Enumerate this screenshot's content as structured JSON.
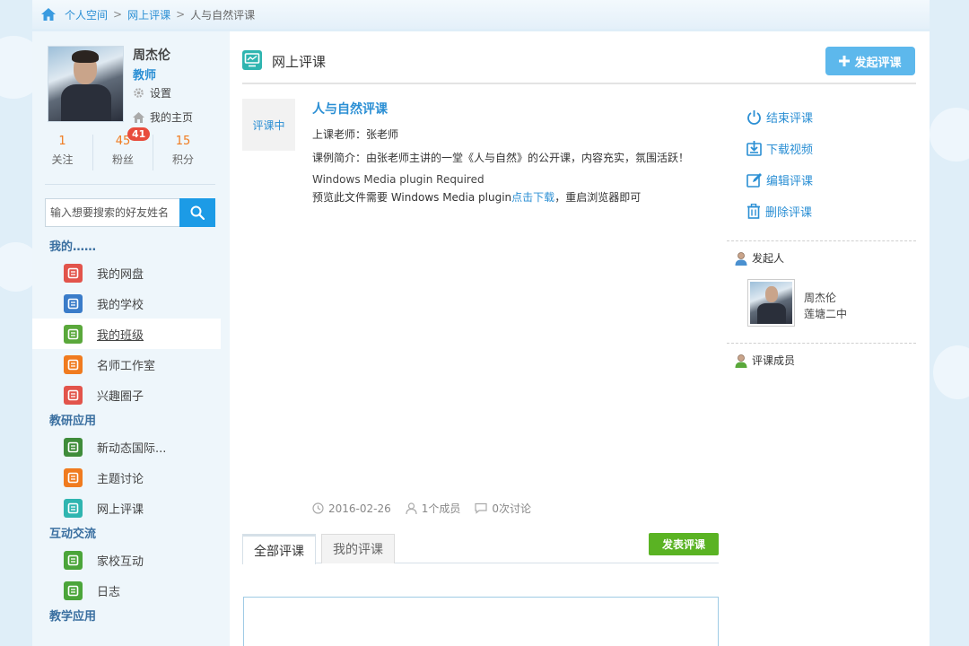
{
  "breadcrumb": {
    "items": [
      "个人空间",
      "网上评课"
    ],
    "separator": ">",
    "current": "人与自然评课"
  },
  "profile": {
    "name": "周杰伦",
    "role": "教师",
    "settings_label": "设置",
    "homepage_label": "我的主页",
    "stats": [
      {
        "num": "1",
        "label": "关注"
      },
      {
        "num": "45",
        "label": "粉丝",
        "badge": "41"
      },
      {
        "num": "15",
        "label": "积分"
      }
    ]
  },
  "search": {
    "placeholder": "输入想要搜索的好友姓名"
  },
  "menu": {
    "groups": [
      {
        "title": "我的……",
        "items": [
          {
            "label": "我的网盘",
            "color": "#e2544b",
            "icon": "cloud-disk-icon"
          },
          {
            "label": "我的学校",
            "color": "#3a7cc9",
            "icon": "school-icon"
          },
          {
            "label": "我的班级",
            "color": "#5aa83b",
            "icon": "class-icon",
            "active": true
          },
          {
            "label": "名师工作室",
            "color": "#f07b1f",
            "icon": "studio-icon"
          },
          {
            "label": "兴趣圈子",
            "color": "#e2544b",
            "icon": "circle-icon"
          }
        ]
      },
      {
        "title": "教研应用",
        "items": [
          {
            "label": "新动态国际...",
            "color": "#3f8c3a",
            "icon": "teaching-icon"
          },
          {
            "label": "主题讨论",
            "color": "#f07b1f",
            "icon": "discussion-icon"
          },
          {
            "label": "网上评课",
            "color": "#2fb5b0",
            "icon": "evaluation-icon"
          }
        ]
      },
      {
        "title": "互动交流",
        "items": [
          {
            "label": "家校互动",
            "color": "#4ba53a",
            "icon": "exchange-icon"
          },
          {
            "label": "日志",
            "color": "#4ba53a",
            "icon": "log-icon"
          }
        ]
      },
      {
        "title": "教学应用",
        "items": []
      }
    ]
  },
  "main": {
    "title": "网上评课",
    "start_button": "发起评课",
    "status": "评课中",
    "course_title": "人与自然评课",
    "teacher": "上课老师：张老师",
    "intro": "课例简介：由张老师主讲的一堂《人与自然》的公开课，内容充实，氛围活跃！",
    "plugin_required": "Windows Media plugin Required",
    "plugin_prefix": "预览此文件需要 Windows Media plugin",
    "plugin_link": "点击下载",
    "plugin_suffix": "，重启浏览器即可",
    "date": "2016-02-26",
    "members": "1个成员",
    "discussions": "0次讨论",
    "tabs": [
      "全部评课",
      "我的评课"
    ],
    "post_button": "发表评课"
  },
  "right_panel": {
    "actions": [
      "结束评课",
      "下载视频",
      "编辑评课",
      "删除评课"
    ],
    "initiator_label": "发起人",
    "initiator_name": "周杰伦",
    "initiator_school": "莲塘二中",
    "members_label": "评课成员"
  },
  "colors": {
    "accent": "#2b8fd4",
    "start_button": "#5db8ec",
    "post_button": "#5ab323",
    "badge": "#e84c3d",
    "stat_num": "#f07b1f"
  }
}
